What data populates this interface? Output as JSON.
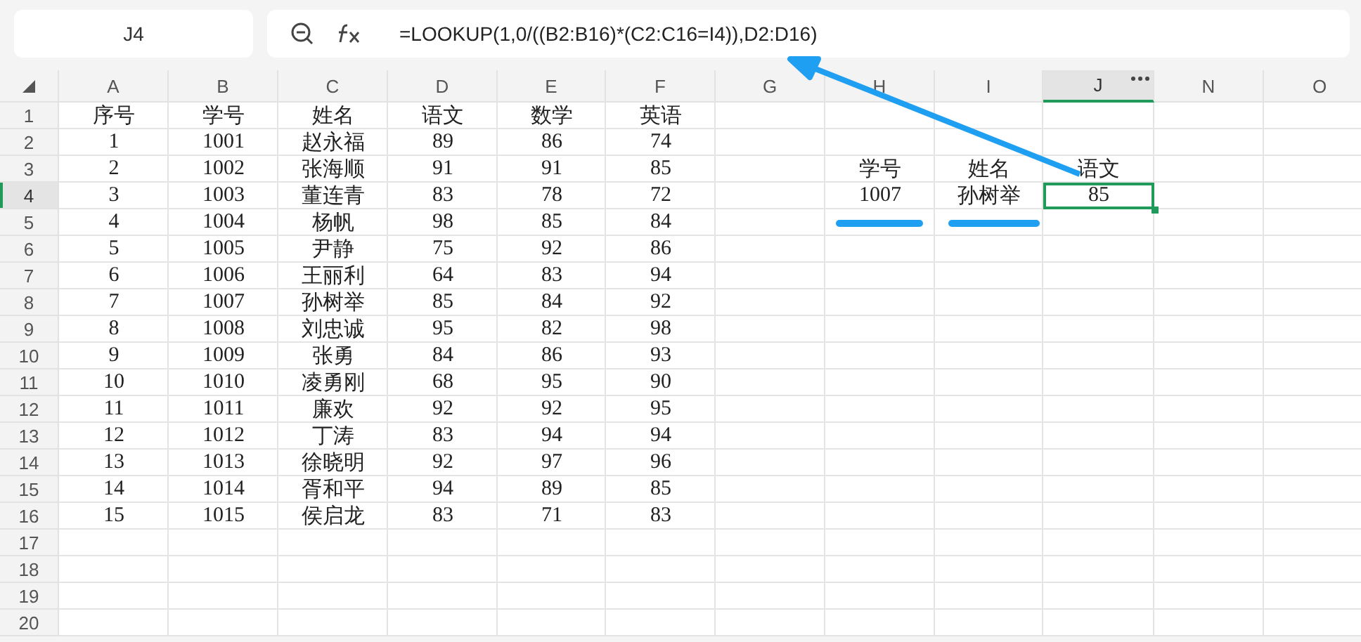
{
  "name_box": "J4",
  "formula": "=LOOKUP(1,0/((B2:B16)*(C2:C16=I4)),D2:D16)",
  "columns": [
    {
      "label": "A",
      "selected": false
    },
    {
      "label": "B",
      "selected": false
    },
    {
      "label": "C",
      "selected": false
    },
    {
      "label": "D",
      "selected": false
    },
    {
      "label": "E",
      "selected": false
    },
    {
      "label": "F",
      "selected": false
    },
    {
      "label": "G",
      "selected": false
    },
    {
      "label": "H",
      "selected": false
    },
    {
      "label": "I",
      "selected": false
    },
    {
      "label": "J",
      "selected": true
    },
    {
      "label": "N",
      "selected": false
    },
    {
      "label": "O",
      "selected": false
    }
  ],
  "rows": [
    {
      "number": "1",
      "selected": false,
      "cells": [
        "序号",
        "学号",
        "姓名",
        "语文",
        "数学",
        "英语"
      ]
    },
    {
      "number": "2",
      "selected": false,
      "cells": [
        "1",
        "1001",
        "赵永福",
        "89",
        "86",
        "74"
      ]
    },
    {
      "number": "3",
      "selected": false,
      "cells": [
        "2",
        "1002",
        "张海顺",
        "91",
        "91",
        "85",
        null,
        "学号",
        "姓名",
        "语文"
      ]
    },
    {
      "number": "4",
      "selected": true,
      "cells": [
        "3",
        "1003",
        "董连青",
        "83",
        "78",
        "72",
        null,
        "1007",
        "孙树举",
        {
          "text": "85",
          "selected": true
        }
      ]
    },
    {
      "number": "5",
      "selected": false,
      "cells": [
        "4",
        "1004",
        "杨帆",
        "98",
        "85",
        "84"
      ]
    },
    {
      "number": "6",
      "selected": false,
      "cells": [
        "5",
        "1005",
        "尹静",
        "75",
        "92",
        "86"
      ]
    },
    {
      "number": "7",
      "selected": false,
      "cells": [
        "6",
        "1006",
        "王丽利",
        "64",
        "83",
        "94"
      ]
    },
    {
      "number": "8",
      "selected": false,
      "cells": [
        "7",
        "1007",
        "孙树举",
        "85",
        "84",
        "92"
      ]
    },
    {
      "number": "9",
      "selected": false,
      "cells": [
        "8",
        "1008",
        "刘忠诚",
        "95",
        "82",
        "98"
      ]
    },
    {
      "number": "10",
      "selected": false,
      "cells": [
        "9",
        "1009",
        "张勇",
        "84",
        "86",
        "93"
      ]
    },
    {
      "number": "11",
      "selected": false,
      "cells": [
        "10",
        "1010",
        "凌勇刚",
        "68",
        "95",
        "90"
      ]
    },
    {
      "number": "12",
      "selected": false,
      "cells": [
        "11",
        "1011",
        "廉欢",
        "92",
        "92",
        "95"
      ]
    },
    {
      "number": "13",
      "selected": false,
      "cells": [
        "12",
        "1012",
        "丁涛",
        "83",
        "94",
        "94"
      ]
    },
    {
      "number": "14",
      "selected": false,
      "cells": [
        "13",
        "1013",
        "徐晓明",
        "92",
        "97",
        "96"
      ]
    },
    {
      "number": "15",
      "selected": false,
      "cells": [
        "14",
        "1014",
        "胥和平",
        "94",
        "89",
        "85"
      ]
    },
    {
      "number": "16",
      "selected": false,
      "cells": [
        "15",
        "1015",
        "侯启龙",
        "83",
        "71",
        "83"
      ]
    },
    {
      "number": "17",
      "selected": false
    },
    {
      "number": "18",
      "selected": false
    },
    {
      "number": "19",
      "selected": false
    },
    {
      "number": "20",
      "selected": false
    }
  ]
}
